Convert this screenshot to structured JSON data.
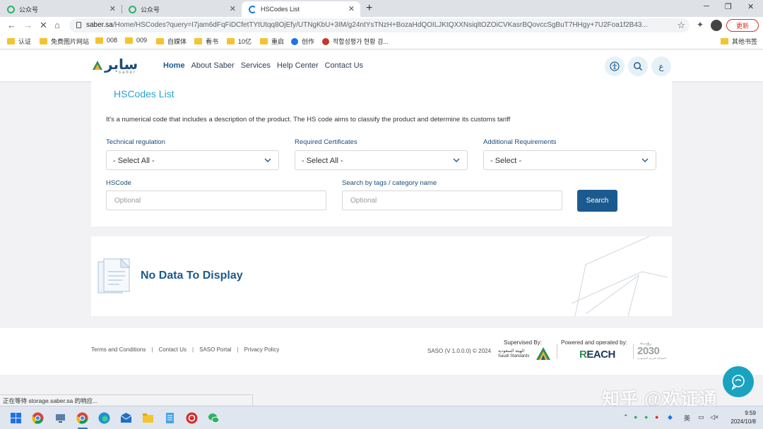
{
  "browser": {
    "tabs": [
      {
        "title": "公众号"
      },
      {
        "title": "公众号"
      },
      {
        "title": "HSCodes List",
        "active": true
      }
    ],
    "url_host": "saber.sa",
    "url_path": "/Home/HSCodes?query=I7jam6dFqFiDCfetTYtUtqq8OjEfy/UTNgKbU+3IM/g24ntYsTNzH+BozaHdQOILJKtQXXNsiqltOZOiCVKasrBQovccSgBuT7HHgy+7U2Foa1f2B43...",
    "update_label": "更新",
    "bookmarks": [
      "认证",
      "免费图片网站",
      "008",
      "009",
      "自媒体",
      "看书",
      "10亿",
      "重启",
      "创作",
      "적합성평가 현황 검...",
      "其他书签"
    ],
    "status_text": "正在等待 storage.saber.sa 的响应..."
  },
  "site": {
    "logo_ar": "سابر",
    "logo_en": "saber",
    "nav": [
      "Home",
      "About Saber",
      "Services",
      "Help Center",
      "Contact Us"
    ],
    "lang_button": "ع"
  },
  "card": {
    "title": "HSCodes List",
    "description": "It's a numerical code that includes a description of the product. The HS code aims to classify the product and determine its customs tariff",
    "filters": {
      "technical_regulation": {
        "label": "Technical regulation",
        "value": "- Select All -"
      },
      "required_certificates": {
        "label": "Required Certificates",
        "value": "- Select All -"
      },
      "additional_requirements": {
        "label": "Additional Requirements",
        "value": "- Select -"
      }
    },
    "hscode": {
      "label": "HSCode",
      "placeholder": "Optional"
    },
    "tags": {
      "label": "Search by tags / category name",
      "placeholder": "Optional"
    },
    "search_button": "Search"
  },
  "results": {
    "empty_message": "No Data To Display"
  },
  "footer": {
    "links": [
      "Terms and Conditions",
      "Contact Us",
      "SASO Portal",
      "Privacy Policy"
    ],
    "version": "SASO (V 1.0.0.0) © 2024",
    "supervised_by": "Supervised By:",
    "saso_ar": "الهيئة السعودية",
    "saso_en": "Saudi Standards",
    "powered_by": "Powered and operated by:",
    "reach_r": "R",
    "reach_rest": "EACH",
    "vision_ar": "رؤيـــة",
    "vision_year": "2030",
    "vision_sub": "المملكة العربية السعودية"
  },
  "watermark": "知乎 @欢证通",
  "taskbar": {
    "time": "9:59",
    "date": "2024/10/8",
    "tray_ime": "英"
  },
  "colors": {
    "brand_blue": "#1b5a8f",
    "title_cyan": "#2aa4d0",
    "chat_teal": "#1aa3c0"
  }
}
